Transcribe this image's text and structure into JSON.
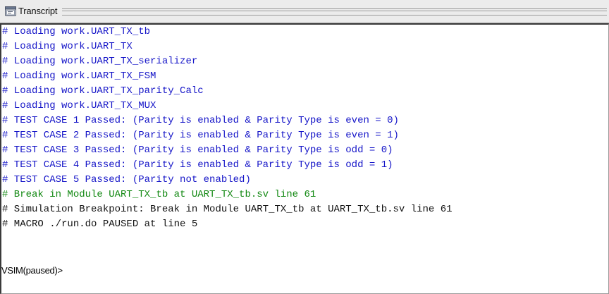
{
  "window": {
    "title": "Transcript",
    "icon": "console-icon"
  },
  "colors": {
    "info": "#1515c8",
    "breakpoint": "#118811",
    "normal": "#111111"
  },
  "transcript": {
    "lines": [
      {
        "text": "# Loading work.UART_TX_tb",
        "kind": "info"
      },
      {
        "text": "# Loading work.UART_TX",
        "kind": "info"
      },
      {
        "text": "# Loading work.UART_TX_serializer",
        "kind": "info"
      },
      {
        "text": "# Loading work.UART_TX_FSM",
        "kind": "info"
      },
      {
        "text": "# Loading work.UART_TX_parity_Calc",
        "kind": "info"
      },
      {
        "text": "# Loading work.UART_TX_MUX",
        "kind": "info"
      },
      {
        "text": "# TEST CASE 1 Passed: (Parity is enabled & Parity Type is even = 0)",
        "kind": "info"
      },
      {
        "text": "# TEST CASE 2 Passed: (Parity is enabled & Parity Type is even = 1)",
        "kind": "info"
      },
      {
        "text": "# TEST CASE 3 Passed: (Parity is enabled & Parity Type is odd = 0)",
        "kind": "info"
      },
      {
        "text": "# TEST CASE 4 Passed: (Parity is enabled & Parity Type is odd = 1)",
        "kind": "info"
      },
      {
        "text": "# TEST CASE 5 Passed: (Parity not enabled)",
        "kind": "info"
      },
      {
        "text": "# Break in Module UART_TX_tb at UART_TX_tb.sv line 61",
        "kind": "breakpoint"
      },
      {
        "text": "# Simulation Breakpoint: Break in Module UART_TX_tb at UART_TX_tb.sv line 61",
        "kind": "normal"
      },
      {
        "text": "# MACRO ./run.do PAUSED at line 5",
        "kind": "normal"
      }
    ],
    "prompt": "VSIM(paused)>"
  }
}
